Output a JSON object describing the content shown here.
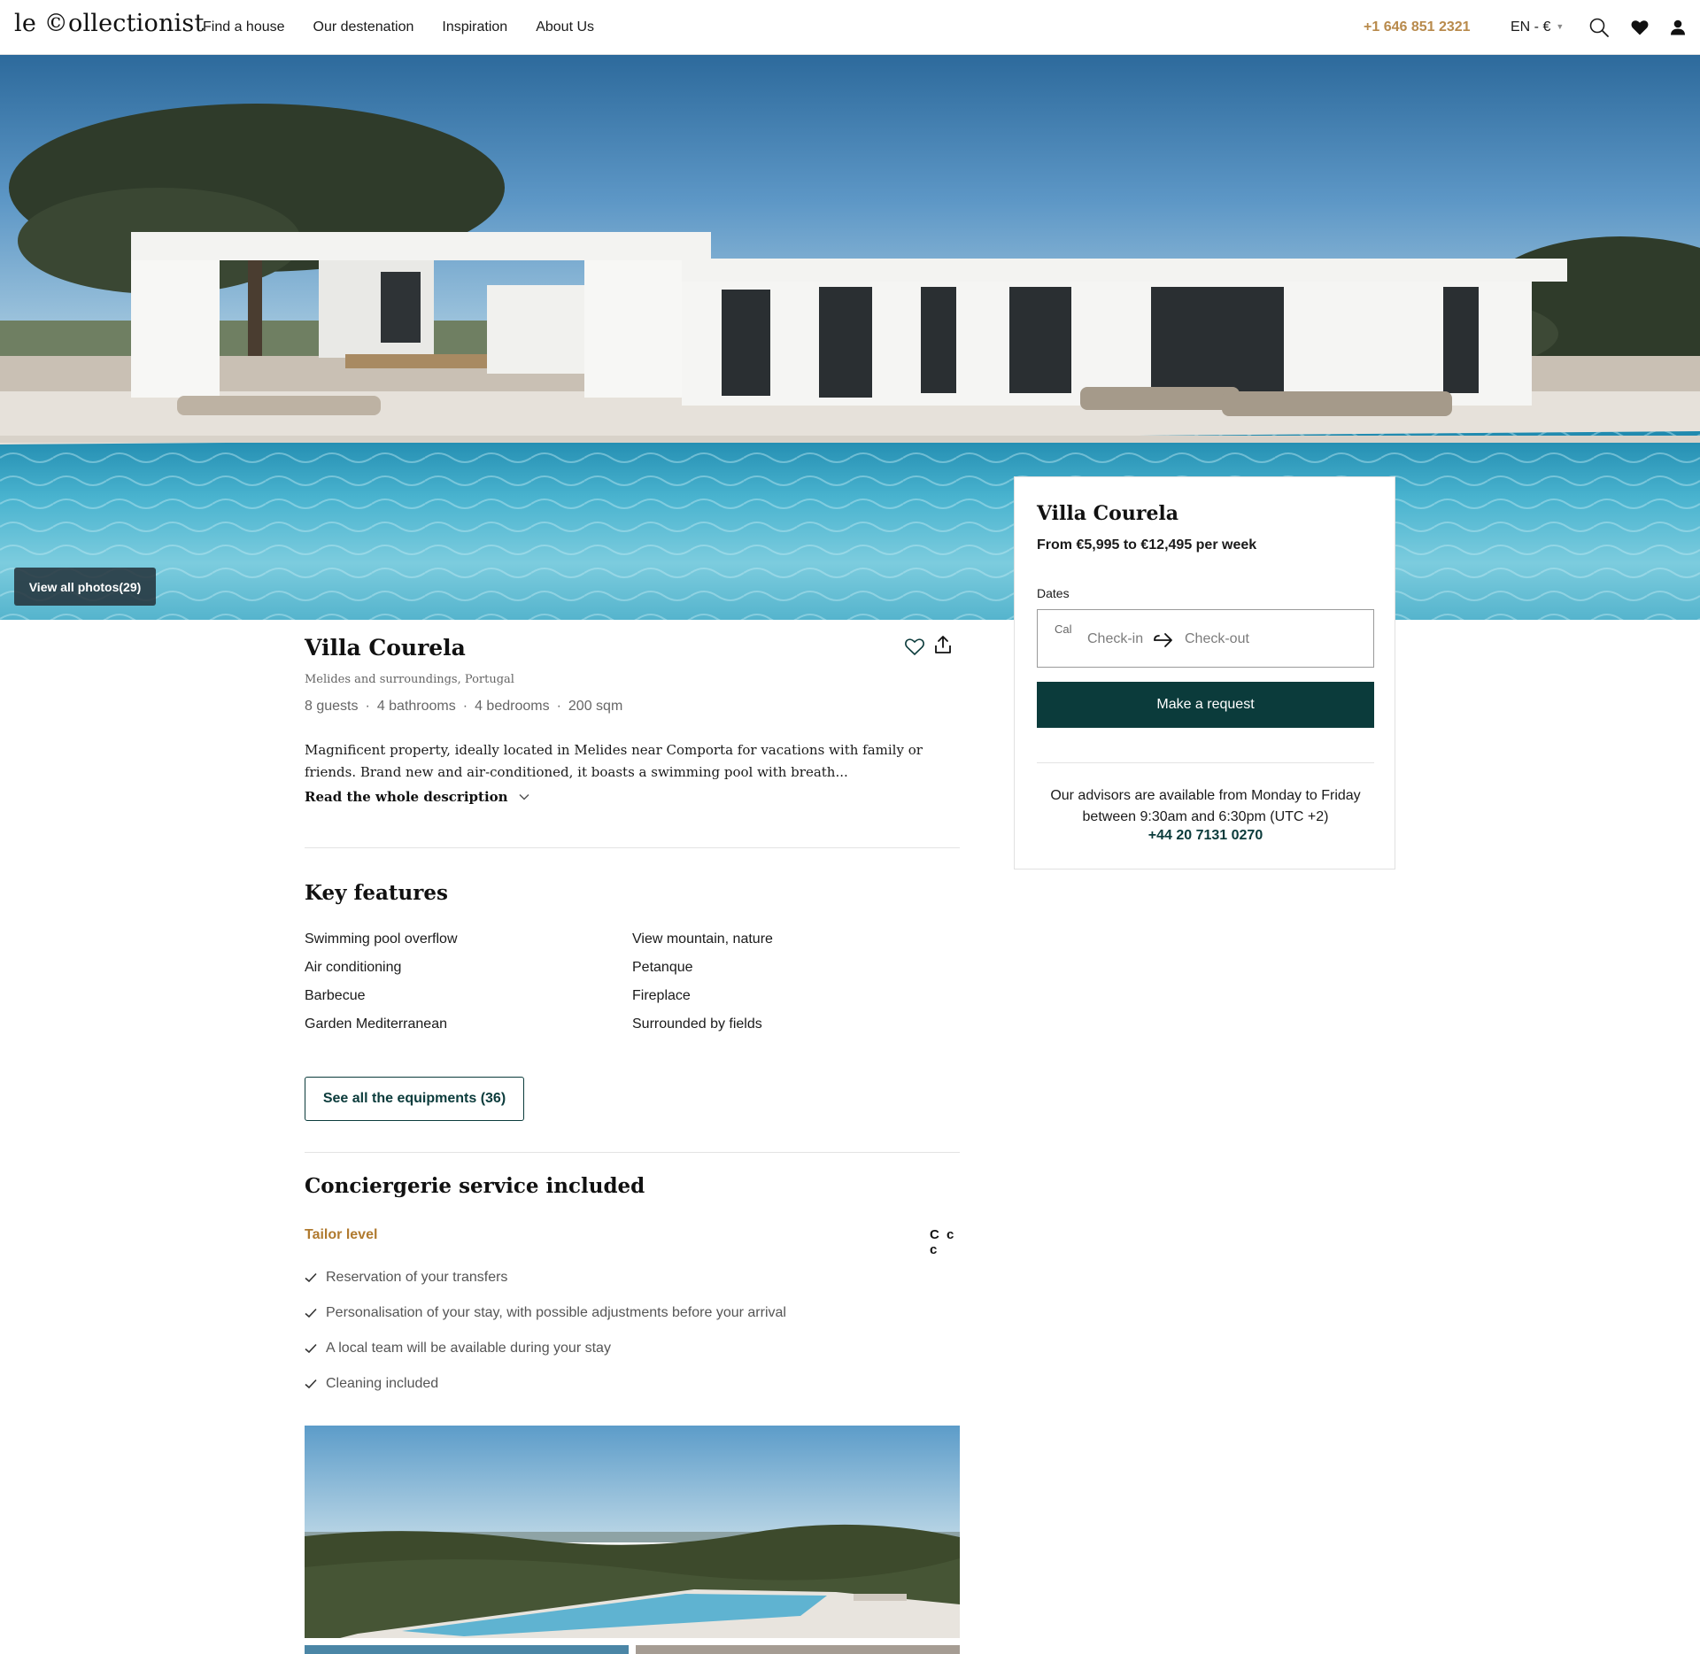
{
  "header": {
    "logo": "le ©ollectionist",
    "nav": [
      "Find a house",
      "Our destenation",
      "Inspiration",
      "About Us"
    ],
    "phone": "+1 646 851 2321",
    "lang": "EN - €",
    "icons": [
      "search-icon",
      "heart-icon",
      "user-icon"
    ]
  },
  "hero": {
    "photos_button": "View all photos(29)"
  },
  "booking": {
    "title": "Villa Courela",
    "price": "From €5,995 to €12,495 per week",
    "dates_label": "Dates",
    "calendar_alt": "Cal",
    "checkin_placeholder": "Check-in",
    "checkout_placeholder": "Check-out",
    "request_button": "Make a request",
    "advisors_text": "Our advisors are available from Monday to Friday between 9:30am and 6:30pm (UTC +2)",
    "advisors_phone": "+44 20 7131 0270"
  },
  "villa": {
    "title": "Villa Courela",
    "location": "Melides and surroundings,  Portugal",
    "specs": [
      "8 guests",
      "4 bathrooms",
      "4 bedrooms",
      "200 sqm"
    ],
    "description": "Magnificent property, ideally located in Melides near Comporta for vacations with family or friends. Brand new and air-conditioned, it boasts a swimming pool with breath...",
    "read_more": "Read the whole description"
  },
  "key_features": {
    "title": "Key features",
    "items": [
      "Swimming pool overflow",
      "View mountain, nature",
      "Air conditioning",
      "Petanque",
      "Barbecue",
      "Fireplace",
      "Garden Mediterranean",
      "Surrounded by fields"
    ],
    "equipment_button": "See all the equipments (36)"
  },
  "concierge": {
    "title": "Conciergerie service included",
    "level": "Tailor level",
    "level_badge": "C c c",
    "items": [
      "Reservation of your transfers",
      "Personalisation of your stay, with possible adjustments before your arrival",
      "A local team will be available during your stay",
      "Cleaning included"
    ]
  },
  "colors": {
    "accent_gold": "#b88a4c",
    "brand_dark_green": "#0b3b3b",
    "tailor_level": "#b07a2f"
  }
}
